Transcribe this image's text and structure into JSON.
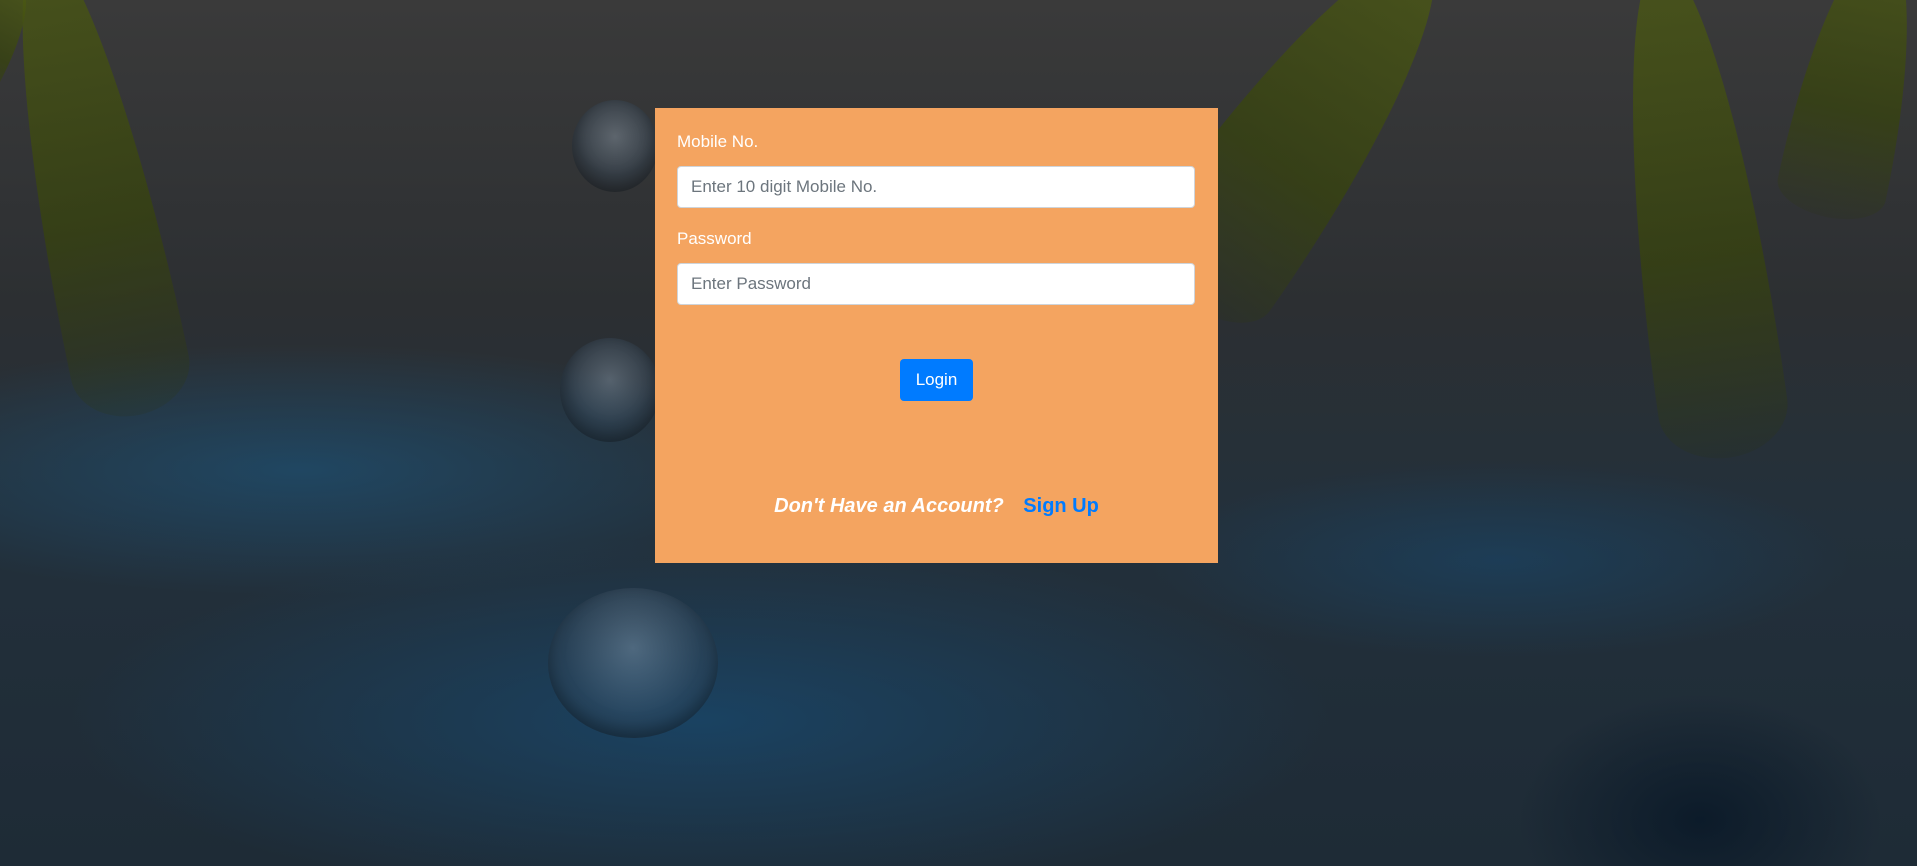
{
  "login_form": {
    "mobile_label": "Mobile No.",
    "mobile_placeholder": "Enter 10 digit Mobile No.",
    "mobile_value": "",
    "password_label": "Password",
    "password_placeholder": "Enter Password",
    "password_value": "",
    "login_button": "Login",
    "signup_prompt": "Don't Have an Account?",
    "signup_link": "Sign Up"
  },
  "colors": {
    "card_background": "#f4a460",
    "primary": "#007bff",
    "label_text": "#ffffff"
  }
}
